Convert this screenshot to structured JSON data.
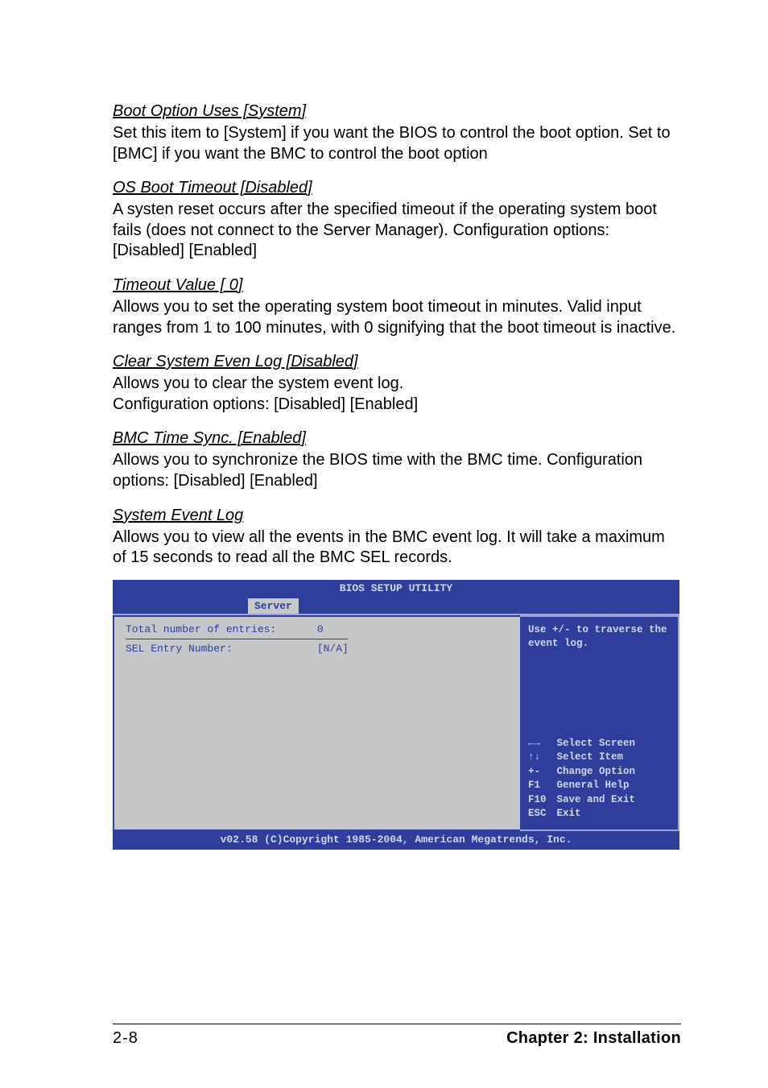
{
  "sections": [
    {
      "heading": "Boot Option Uses [System]",
      "body": "Set this item to [System] if you want the BIOS to control the boot option. Set to [BMC] if you want the BMC to control the boot option"
    },
    {
      "heading": "OS Boot Timeout [Disabled]",
      "body": "A systen reset occurs after the specified timeout if the operating system boot fails (does not connect to the Server Manager). Configuration options: [Disabled] [Enabled]"
    },
    {
      "heading": "Timeout Value [  0]",
      "body": "Allows you to set the operating system boot timeout in minutes. Valid input ranges from 1 to 100 minutes, with 0 signifying that the boot timeout is inactive."
    },
    {
      "heading": "Clear System Even Log [Disabled]",
      "body": "Allows you to clear the system event log.\nConfiguration options: [Disabled] [Enabled]"
    },
    {
      "heading": "BMC Time Sync. [Enabled]",
      "body": "Allows you to synchronize the BIOS time with the BMC time. Configuration options: [Disabled] [Enabled]"
    },
    {
      "heading": "System Event Log",
      "body": "Allows you to view all the events in the BMC event log. It will take a maximum of 15 seconds to read all the BMC SEL records."
    }
  ],
  "bios": {
    "title": "BIOS SETUP UTILITY",
    "tab": "Server",
    "left": {
      "total_label": "Total number of entries:",
      "total_value": "0",
      "sel_label": "SEL Entry Number:",
      "sel_value": "[N/A]"
    },
    "help_top": "Use +/- to traverse the event log.",
    "keys": [
      {
        "sym": "←→",
        "txt": "Select Screen"
      },
      {
        "sym": "↑↓",
        "txt": "Select Item"
      },
      {
        "sym": "+-",
        "txt": "Change Option"
      },
      {
        "sym": "F1",
        "txt": "General Help"
      },
      {
        "sym": "F10",
        "txt": "Save and Exit"
      },
      {
        "sym": "ESC",
        "txt": "Exit"
      }
    ],
    "footer": "v02.58 (C)Copyright 1985-2004, American Megatrends, Inc."
  },
  "page_footer": {
    "pagenum": "2-8",
    "chapter": "Chapter 2: Installation"
  }
}
